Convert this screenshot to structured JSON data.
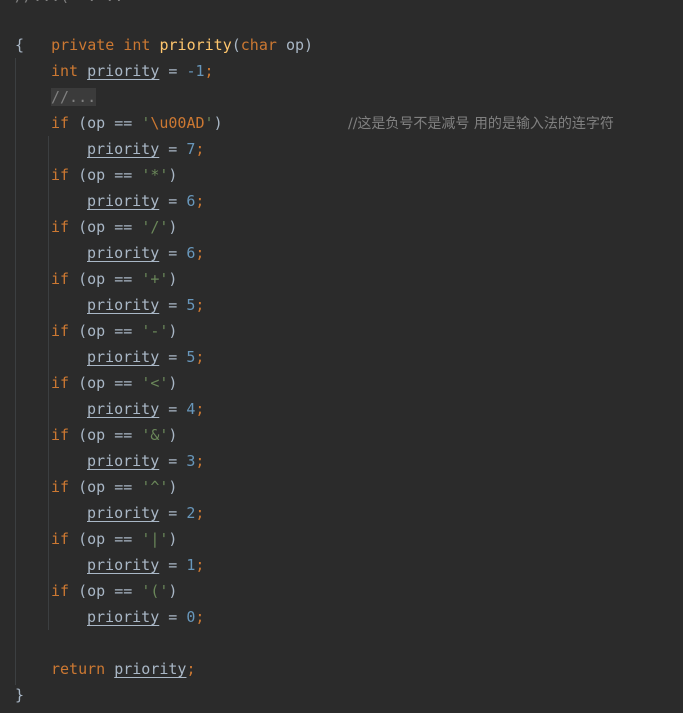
{
  "partial_top": "//...(  . ..  ",
  "signature": {
    "modifier": "private",
    "type": "int",
    "name": "priority",
    "param_type": "char",
    "param_name": "op"
  },
  "open_brace": "{",
  "close_brace": "}",
  "decl": {
    "type": "int",
    "var": "priority",
    "op": " = ",
    "value": "-1"
  },
  "folded": "//...",
  "assign_var": "priority",
  "if_kw": "if",
  "cond_prefix": " (op == ",
  "cases": [
    {
      "char": "'",
      "inner_escape": "\\u00AD",
      "value": "7",
      "comment": "//这是负号不是减号 用的是输入法的连字符"
    },
    {
      "inner": "*",
      "value": "6"
    },
    {
      "inner": "/",
      "value": "6"
    },
    {
      "inner": "+",
      "value": "5"
    },
    {
      "inner": "-",
      "value": "5"
    },
    {
      "inner": "<",
      "value": "4"
    },
    {
      "inner": "&",
      "value": "3"
    },
    {
      "inner": "^",
      "value": "2"
    },
    {
      "inner": "|",
      "value": "1"
    },
    {
      "inner": "(",
      "value": "0"
    }
  ],
  "return_kw": "return",
  "return_var": "priority",
  "colors": {
    "background": "#2b2b2b",
    "keyword": "#cc7832",
    "function": "#ffc66d",
    "number": "#6897bb",
    "string": "#6a8759",
    "comment": "#808080",
    "text": "#a9b7c6"
  }
}
